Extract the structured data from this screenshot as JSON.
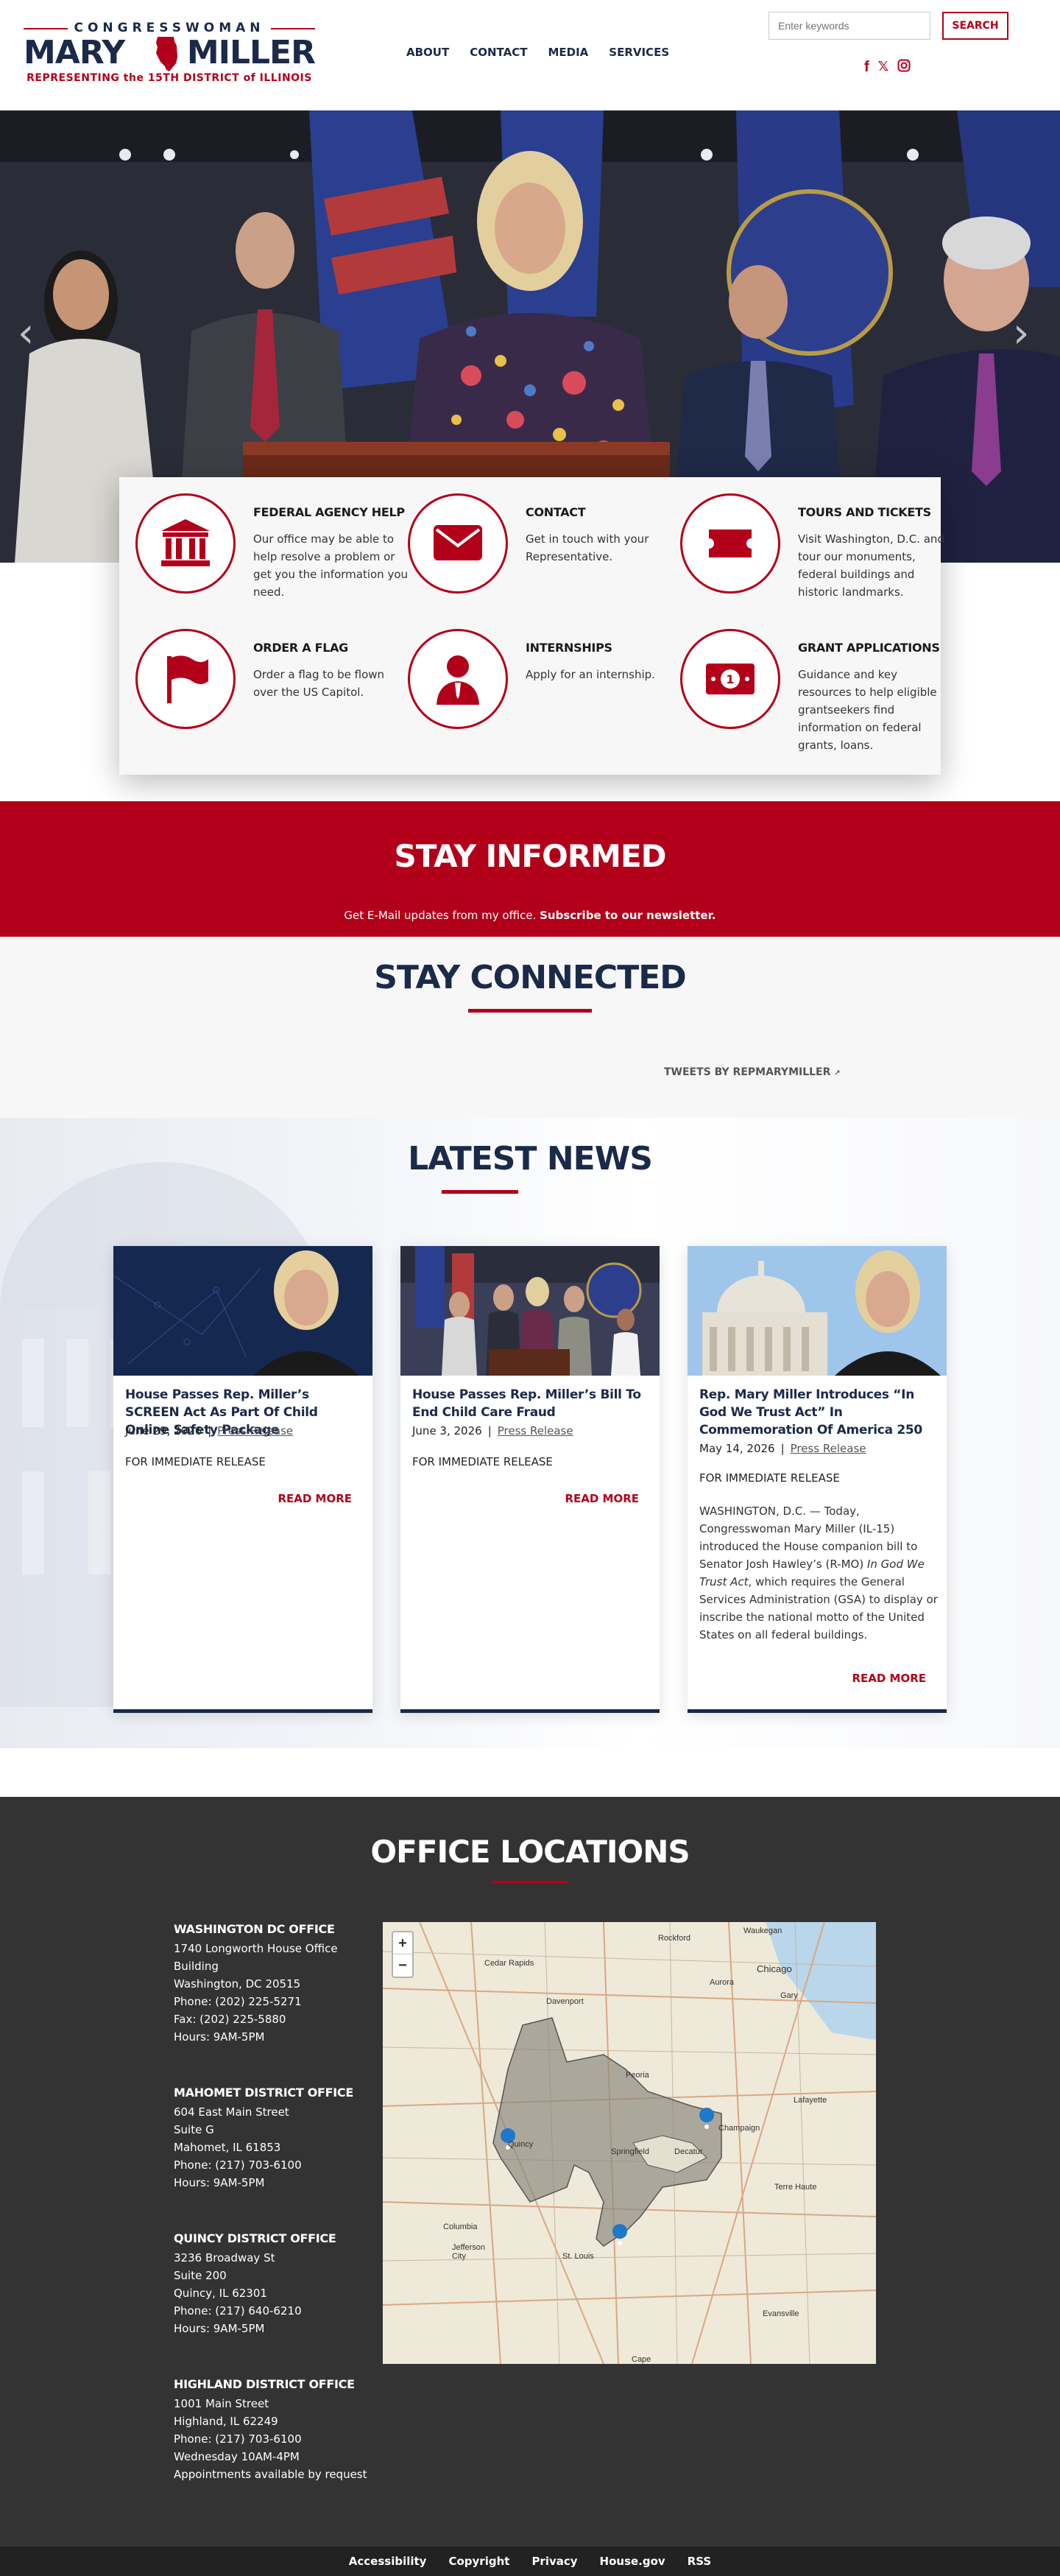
{
  "header": {
    "logo": {
      "top": "CONGRESSWOMAN",
      "first_name": "MARY",
      "last_name": "MILLER",
      "tagline": "REPRESENTING the 15TH DISTRICT of ILLINOIS"
    },
    "nav": [
      "ABOUT",
      "CONTACT",
      "MEDIA",
      "SERVICES"
    ],
    "search_placeholder": "Enter keywords",
    "search_button": "SEARCH",
    "social_icons": [
      "facebook-icon",
      "x-icon",
      "instagram-icon"
    ]
  },
  "hero": {
    "prev_icon": "chevron-left-icon",
    "next_icon": "chevron-right-icon"
  },
  "services": [
    {
      "title": "FEDERAL AGENCY HELP",
      "desc": "Our office may be able to help resolve a problem or get you the information you need.",
      "icon": "capitol-building-icon"
    },
    {
      "title": "CONTACT",
      "desc": "Get in touch with your Representative.",
      "icon": "envelope-icon"
    },
    {
      "title": "TOURS AND TICKETS",
      "desc": "Visit Washington, D.C. and tour our monuments, federal buildings and historic landmarks.",
      "icon": "ticket-icon"
    },
    {
      "title": "ORDER A FLAG",
      "desc": "Order a flag to be flown over the US Capitol.",
      "icon": "flag-icon"
    },
    {
      "title": "INTERNSHIPS",
      "desc": "Apply for an internship.",
      "icon": "person-icon"
    },
    {
      "title": "GRANT APPLICATIONS",
      "desc": "Guidance and key resources to help eligible grantseekers find information on federal grants, loans.",
      "icon": "money-icon"
    }
  ],
  "stay_informed": {
    "title": "STAY INFORMED",
    "text": "Get E-Mail updates from my office.",
    "link": "Subscribe to our newsletter."
  },
  "stay_connected": {
    "title": "STAY CONNECTED",
    "tweets": "TWEETS BY REPMARYMILLER"
  },
  "latest_news": {
    "title": "LATEST NEWS",
    "cards": [
      {
        "title": "House Passes Rep. Miller’s SCREEN Act As Part Of Child Online Safety Package",
        "date": "June 29, 2026",
        "category": "Press Release",
        "release": "FOR IMMEDIATE RELEASE",
        "body": "",
        "more": "READ MORE"
      },
      {
        "title": "House Passes Rep. Miller’s Bill To End Child Care Fraud",
        "date": "June 3, 2026",
        "category": "Press Release",
        "release": "FOR IMMEDIATE RELEASE",
        "body": "",
        "more": "READ MORE"
      },
      {
        "title": "Rep. Mary Miller Introduces “In God We Trust Act” In Commemoration Of America 250",
        "date": "May 14, 2026",
        "category": "Press Release",
        "release": "FOR IMMEDIATE RELEASE",
        "body_pre": "WASHINGTON, D.C. — Today, Congresswoman Mary Miller (IL-15) introduced the House companion bill to Senator Josh Hawley’s (R-MO)",
        "body_italic": "In God We Trust Act",
        "body_post": ", which requires the General Services Administration (GSA) to display or inscribe the national motto of the United States on all federal buildings.",
        "more": "READ MORE"
      }
    ]
  },
  "offices": {
    "title": "OFFICE LOCATIONS",
    "list": [
      {
        "name": "WASHINGTON DC OFFICE",
        "lines": [
          "1740 Longworth House Office",
          "Building",
          "Washington, DC 20515",
          "Phone: (202) 225-5271",
          "Fax: (202) 225-5880",
          "Hours: 9AM-5PM"
        ]
      },
      {
        "name": "MAHOMET DISTRICT OFFICE",
        "lines": [
          "604 East Main Street",
          "Suite G",
          "Mahomet, IL 61853",
          "Phone: (217) 703-6100",
          "Hours: 9AM-5PM"
        ]
      },
      {
        "name": "QUINCY DISTRICT OFFICE",
        "lines": [
          "3236 Broadway St",
          "Suite 200",
          "Quincy, IL 62301",
          "Phone: (217) 640-6210",
          "Hours: 9AM-5PM"
        ]
      },
      {
        "name": "HIGHLAND DISTRICT OFFICE",
        "lines": [
          "1001 Main Street",
          "Highland, IL 62249",
          "Phone: (217) 703-6100",
          "Wednesday 10AM-4PM",
          "Appointments available by request"
        ]
      }
    ],
    "map": {
      "zoom_in": "+",
      "zoom_out": "−",
      "cities": [
        "Waukegan",
        "Rockford",
        "Chicago",
        "Cedar Rapids",
        "Aurora",
        "Gary",
        "Davenport",
        "Peoria",
        "Lafayette",
        "Champaign",
        "Quincy",
        "Springfield",
        "Decatur",
        "Terre Haute",
        "Columbia",
        "Jefferson City",
        "St. Louis",
        "Evansville",
        "Cape"
      ]
    }
  },
  "footer": {
    "links": [
      "Accessibility",
      "Copyright",
      "Privacy",
      "House.gov",
      "RSS"
    ]
  }
}
